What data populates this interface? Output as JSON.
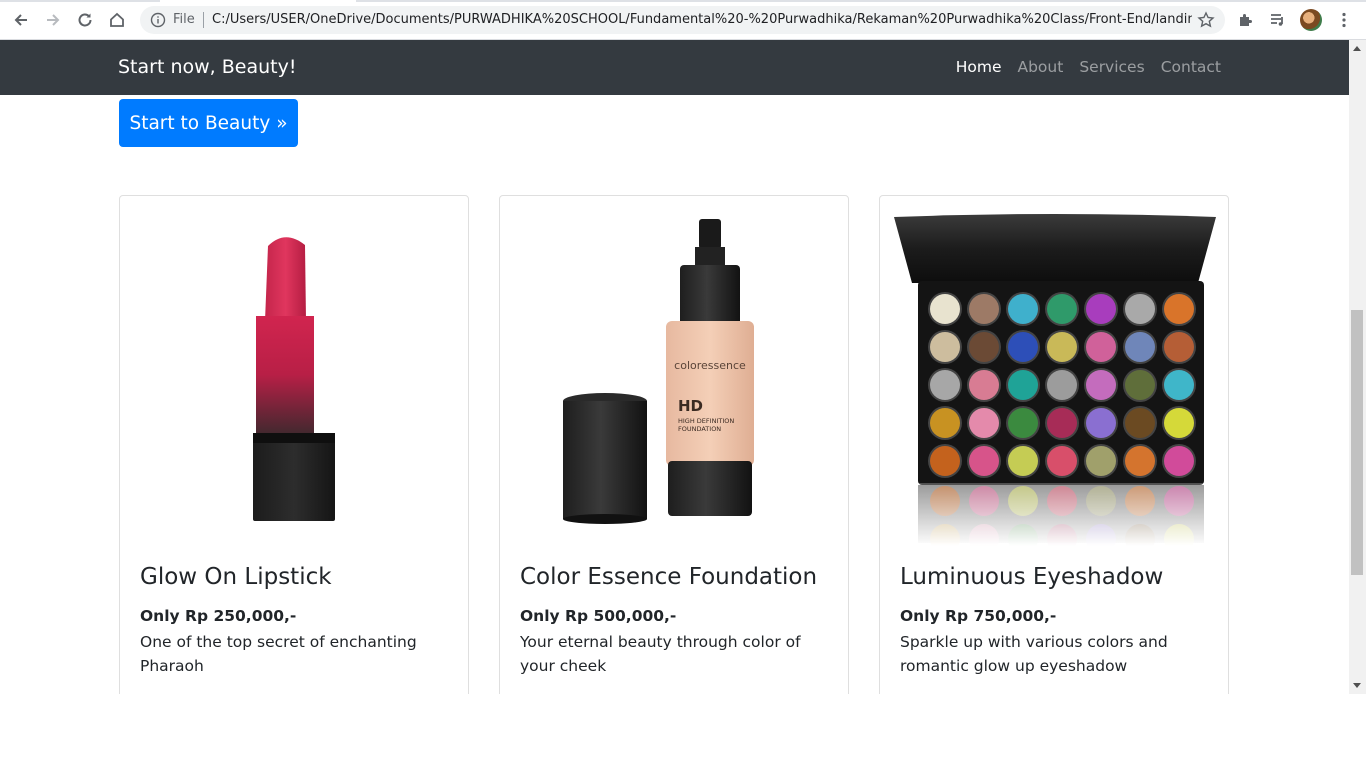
{
  "browser": {
    "scheme_label": "File",
    "url": "C:/Users/USER/OneDrive/Documents/PURWADHIKA%20SCHOOL/Fundamental%20-%20Purwadhika/Rekaman%20Purwadhika%20Class/Front-End/landing..."
  },
  "navbar": {
    "brand": "Start now, Beauty!",
    "links": [
      "Home",
      "About",
      "Services",
      "Contact"
    ],
    "active": "Home"
  },
  "hero": {
    "cta_label": "Start to Beauty »"
  },
  "products": [
    {
      "title": "Glow On Lipstick",
      "price": "Only Rp 250,000,-",
      "description": "One of the top secret of enchanting Pharaoh",
      "image": "lipstick"
    },
    {
      "title": "Color Essence Foundation",
      "price": "Only Rp 500,000,-",
      "description": "Your eternal beauty through color of your cheek",
      "image": "foundation-bottle"
    },
    {
      "title": "Luminuous Eyeshadow",
      "price": "Only Rp 750,000,-",
      "description": "Sparkle up with various colors and romantic glow up eyeshadow",
      "image": "eyeshadow-palette"
    }
  ],
  "foundation_label": {
    "brand": "coloressence",
    "line1": "HD",
    "line2": "HIGH DEFINITION",
    "line3": "FOUNDATION"
  },
  "colors": {
    "navbar_bg": "#343a40",
    "primary": "#007bff",
    "lipstick": "#d1254f"
  }
}
